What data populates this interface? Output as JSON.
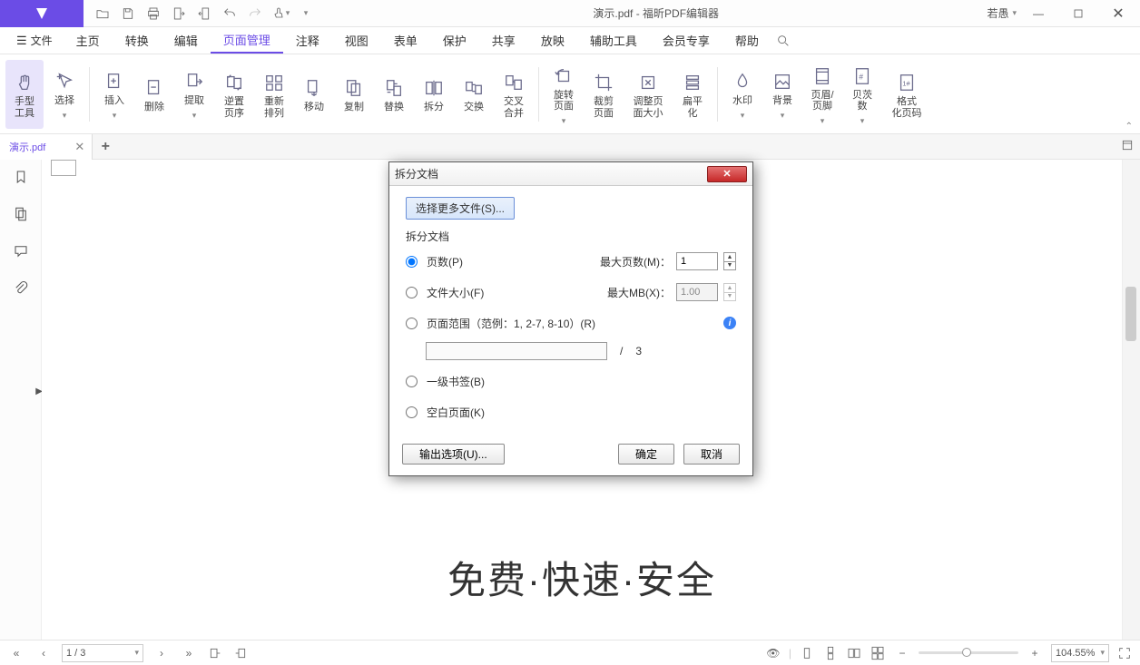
{
  "title": "演示.pdf - 福昕PDF编辑器",
  "user": "若愚",
  "file_menu": "文件",
  "menu": [
    "主页",
    "转换",
    "编辑",
    "页面管理",
    "注释",
    "视图",
    "表单",
    "保护",
    "共享",
    "放映",
    "辅助工具",
    "会员专享",
    "帮助"
  ],
  "menu_active_index": 3,
  "ribbon": {
    "hand": "手型\n工具",
    "select": "选择",
    "insert": "插入",
    "delete": "删除",
    "extract": "提取",
    "reverse": "逆置\n页序",
    "rearrange": "重新\n排列",
    "move": "移动",
    "duplicate": "复制",
    "replace": "替换",
    "split": "拆分",
    "swap": "交换",
    "merge": "交叉\n合并",
    "rotate": "旋转\n页面",
    "crop": "裁剪\n页面",
    "resize": "调整页\n面大小",
    "flatten": "扁平\n化",
    "watermark": "水印",
    "background": "背景",
    "headerfooter": "页眉/\n页脚",
    "bates": "贝茨\n数",
    "formatcode": "格式\n化页码"
  },
  "doctab": "演示.pdf",
  "big_text": "免费·快速·安全",
  "statusbar": {
    "page": "1 / 3",
    "zoom": "104.55%"
  },
  "dialog": {
    "title": "拆分文档",
    "select_more": "选择更多文件(S)...",
    "group": "拆分文档",
    "opt_pages": "页数(P)",
    "max_pages_label": "最大页数(M)：",
    "max_pages_value": "1",
    "opt_size": "文件大小(F)",
    "max_mb_label": "最大MB(X)：",
    "max_mb_value": "1.00",
    "opt_range": "页面范围（范例：1, 2-7, 8-10）(R)",
    "range_total": "3",
    "range_sep": "/",
    "opt_bookmark": "一级书签(B)",
    "opt_blank": "空白页面(K)",
    "output_btn": "输出选项(U)...",
    "ok": "确定",
    "cancel": "取消"
  }
}
